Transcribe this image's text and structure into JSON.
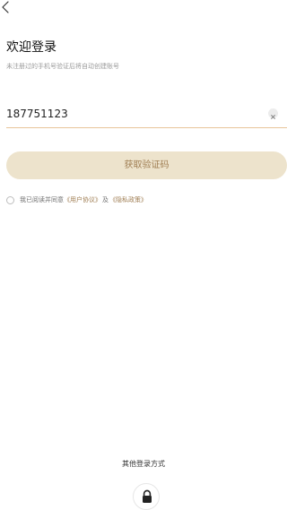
{
  "nav": {
    "back_icon": "chevron-left-icon"
  },
  "header": {
    "title": "欢迎登录",
    "subtitle": "未注册过的手机号验证后将自动创建账号"
  },
  "phone": {
    "value": "187751123",
    "clear_icon": "close-icon"
  },
  "get_code_button": {
    "label": "获取验证码"
  },
  "agreement": {
    "checked": false,
    "text": "我已阅读并同意",
    "user_agreement": "《用户协议》",
    "and": "及",
    "privacy_policy": "《隐私政策》"
  },
  "other_login": {
    "label": "其他登录方式",
    "lock_icon": "lock-icon"
  },
  "colors": {
    "accent": "#9f7d52",
    "button_bg": "#ede3cc",
    "underline": "#e8c49a"
  }
}
